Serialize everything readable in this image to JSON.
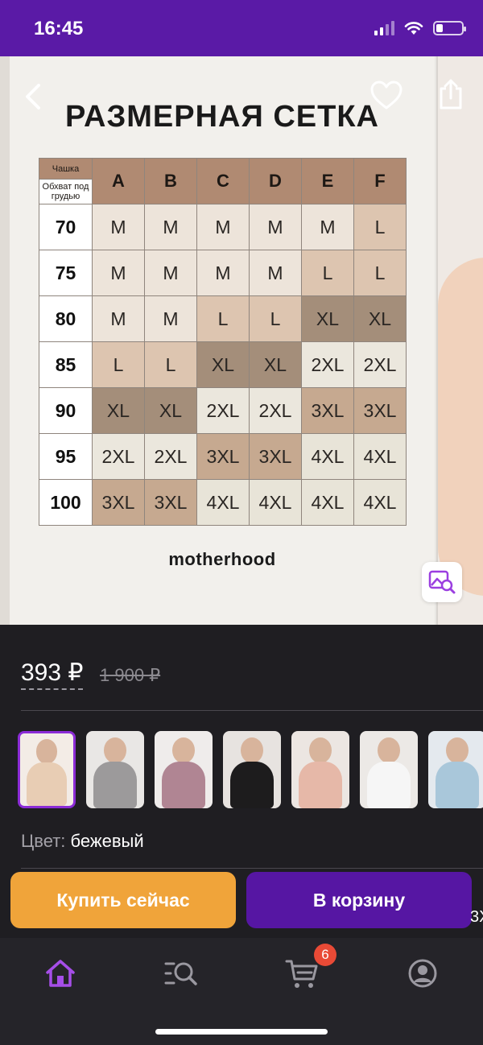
{
  "status_bar": {
    "time": "16:45"
  },
  "gallery": {
    "size_chart": {
      "title": "РАЗМЕРНАЯ СЕТКА",
      "corner_top": "Чашка",
      "corner_bottom": "Обхват под грудью",
      "cups": [
        "A",
        "B",
        "C",
        "D",
        "E",
        "F"
      ],
      "rows": [
        {
          "band": "70",
          "sizes": [
            "M",
            "M",
            "M",
            "M",
            "M",
            "L"
          ]
        },
        {
          "band": "75",
          "sizes": [
            "M",
            "M",
            "M",
            "M",
            "L",
            "L"
          ]
        },
        {
          "band": "80",
          "sizes": [
            "M",
            "M",
            "L",
            "L",
            "XL",
            "XL"
          ]
        },
        {
          "band": "85",
          "sizes": [
            "L",
            "L",
            "XL",
            "XL",
            "2XL",
            "2XL"
          ]
        },
        {
          "band": "90",
          "sizes": [
            "XL",
            "XL",
            "2XL",
            "2XL",
            "3XL",
            "3XL"
          ]
        },
        {
          "band": "95",
          "sizes": [
            "2XL",
            "2XL",
            "3XL",
            "3XL",
            "4XL",
            "4XL"
          ]
        },
        {
          "band": "100",
          "sizes": [
            "3XL",
            "3XL",
            "4XL",
            "4XL",
            "4XL",
            "4XL"
          ]
        }
      ],
      "brand": "motherhood"
    }
  },
  "product": {
    "price": "393 ₽",
    "old_price": "1 900 ₽",
    "color_label": "Цвет:",
    "color_value": "бежевый",
    "thumbnails": [
      {
        "label": "thumb-1",
        "bg": "#f3ece6",
        "garment": "#e8cdb4"
      },
      {
        "label": "thumb-2",
        "bg": "#e9e7e5",
        "garment": "#9c9a9b"
      },
      {
        "label": "thumb-3",
        "bg": "#efeceb",
        "garment": "#b08593"
      },
      {
        "label": "thumb-4",
        "bg": "#e7e3e0",
        "garment": "#1d1c1d"
      },
      {
        "label": "thumb-5",
        "bg": "#ece6e2",
        "garment": "#e6b8a8"
      },
      {
        "label": "thumb-6",
        "bg": "#ece9e6",
        "garment": "#f6f6f6"
      },
      {
        "label": "thumb-7",
        "bg": "#e4e9ee",
        "garment": "#a9c7da"
      }
    ]
  },
  "actions": {
    "buy_now": "Купить сейчас",
    "add_to_cart": "В корзину",
    "peek_text": "3Х"
  },
  "tabbar": {
    "items": [
      "home",
      "catalog-search",
      "cart",
      "profile"
    ],
    "cart_count": "6",
    "accent": "#a64ee8",
    "icon_color": "#9a98a0"
  }
}
